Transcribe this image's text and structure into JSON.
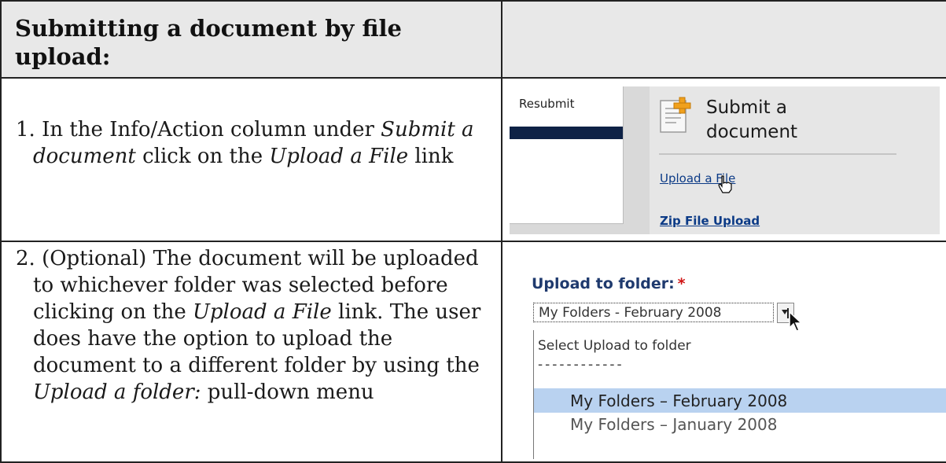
{
  "header": {
    "title": "Submitting a document by file upload:"
  },
  "step1": {
    "number": "1.",
    "text_before": " In the Info/Action column under ",
    "italic_1": "Submit a document",
    "text_mid": " click on the ",
    "italic_2": "Upload a File",
    "text_after": " link"
  },
  "step2": {
    "number": "2.",
    "text_1": " (Optional) The document will be uploaded to whichever folder was selected before clicking on the ",
    "italic_1": "Upload a File",
    "text_2": " link.  The user does have the option to upload the document to a different folder by using the ",
    "italic_2": "Upload a folder:",
    "text_3": " pull-down menu"
  },
  "screenshot1": {
    "resubmit_label": "Resubmit",
    "panel_title": "Submit a document",
    "upload_link": "Upload a File",
    "zip_link": "Zip File Upload",
    "icons": [
      "document-add-icon",
      "hand-pointer-icon"
    ]
  },
  "screenshot2": {
    "label": "Upload to folder:",
    "required_mark": "*",
    "selected_value": "My Folders - February 2008",
    "options": [
      "Select Upload to folder",
      "------------",
      "My Folders – February 2008",
      "My Folders – January 2008"
    ],
    "highlight_color": "#b9d2f0",
    "icons": [
      "dropdown-arrow-icon",
      "mouse-cursor-icon"
    ]
  }
}
